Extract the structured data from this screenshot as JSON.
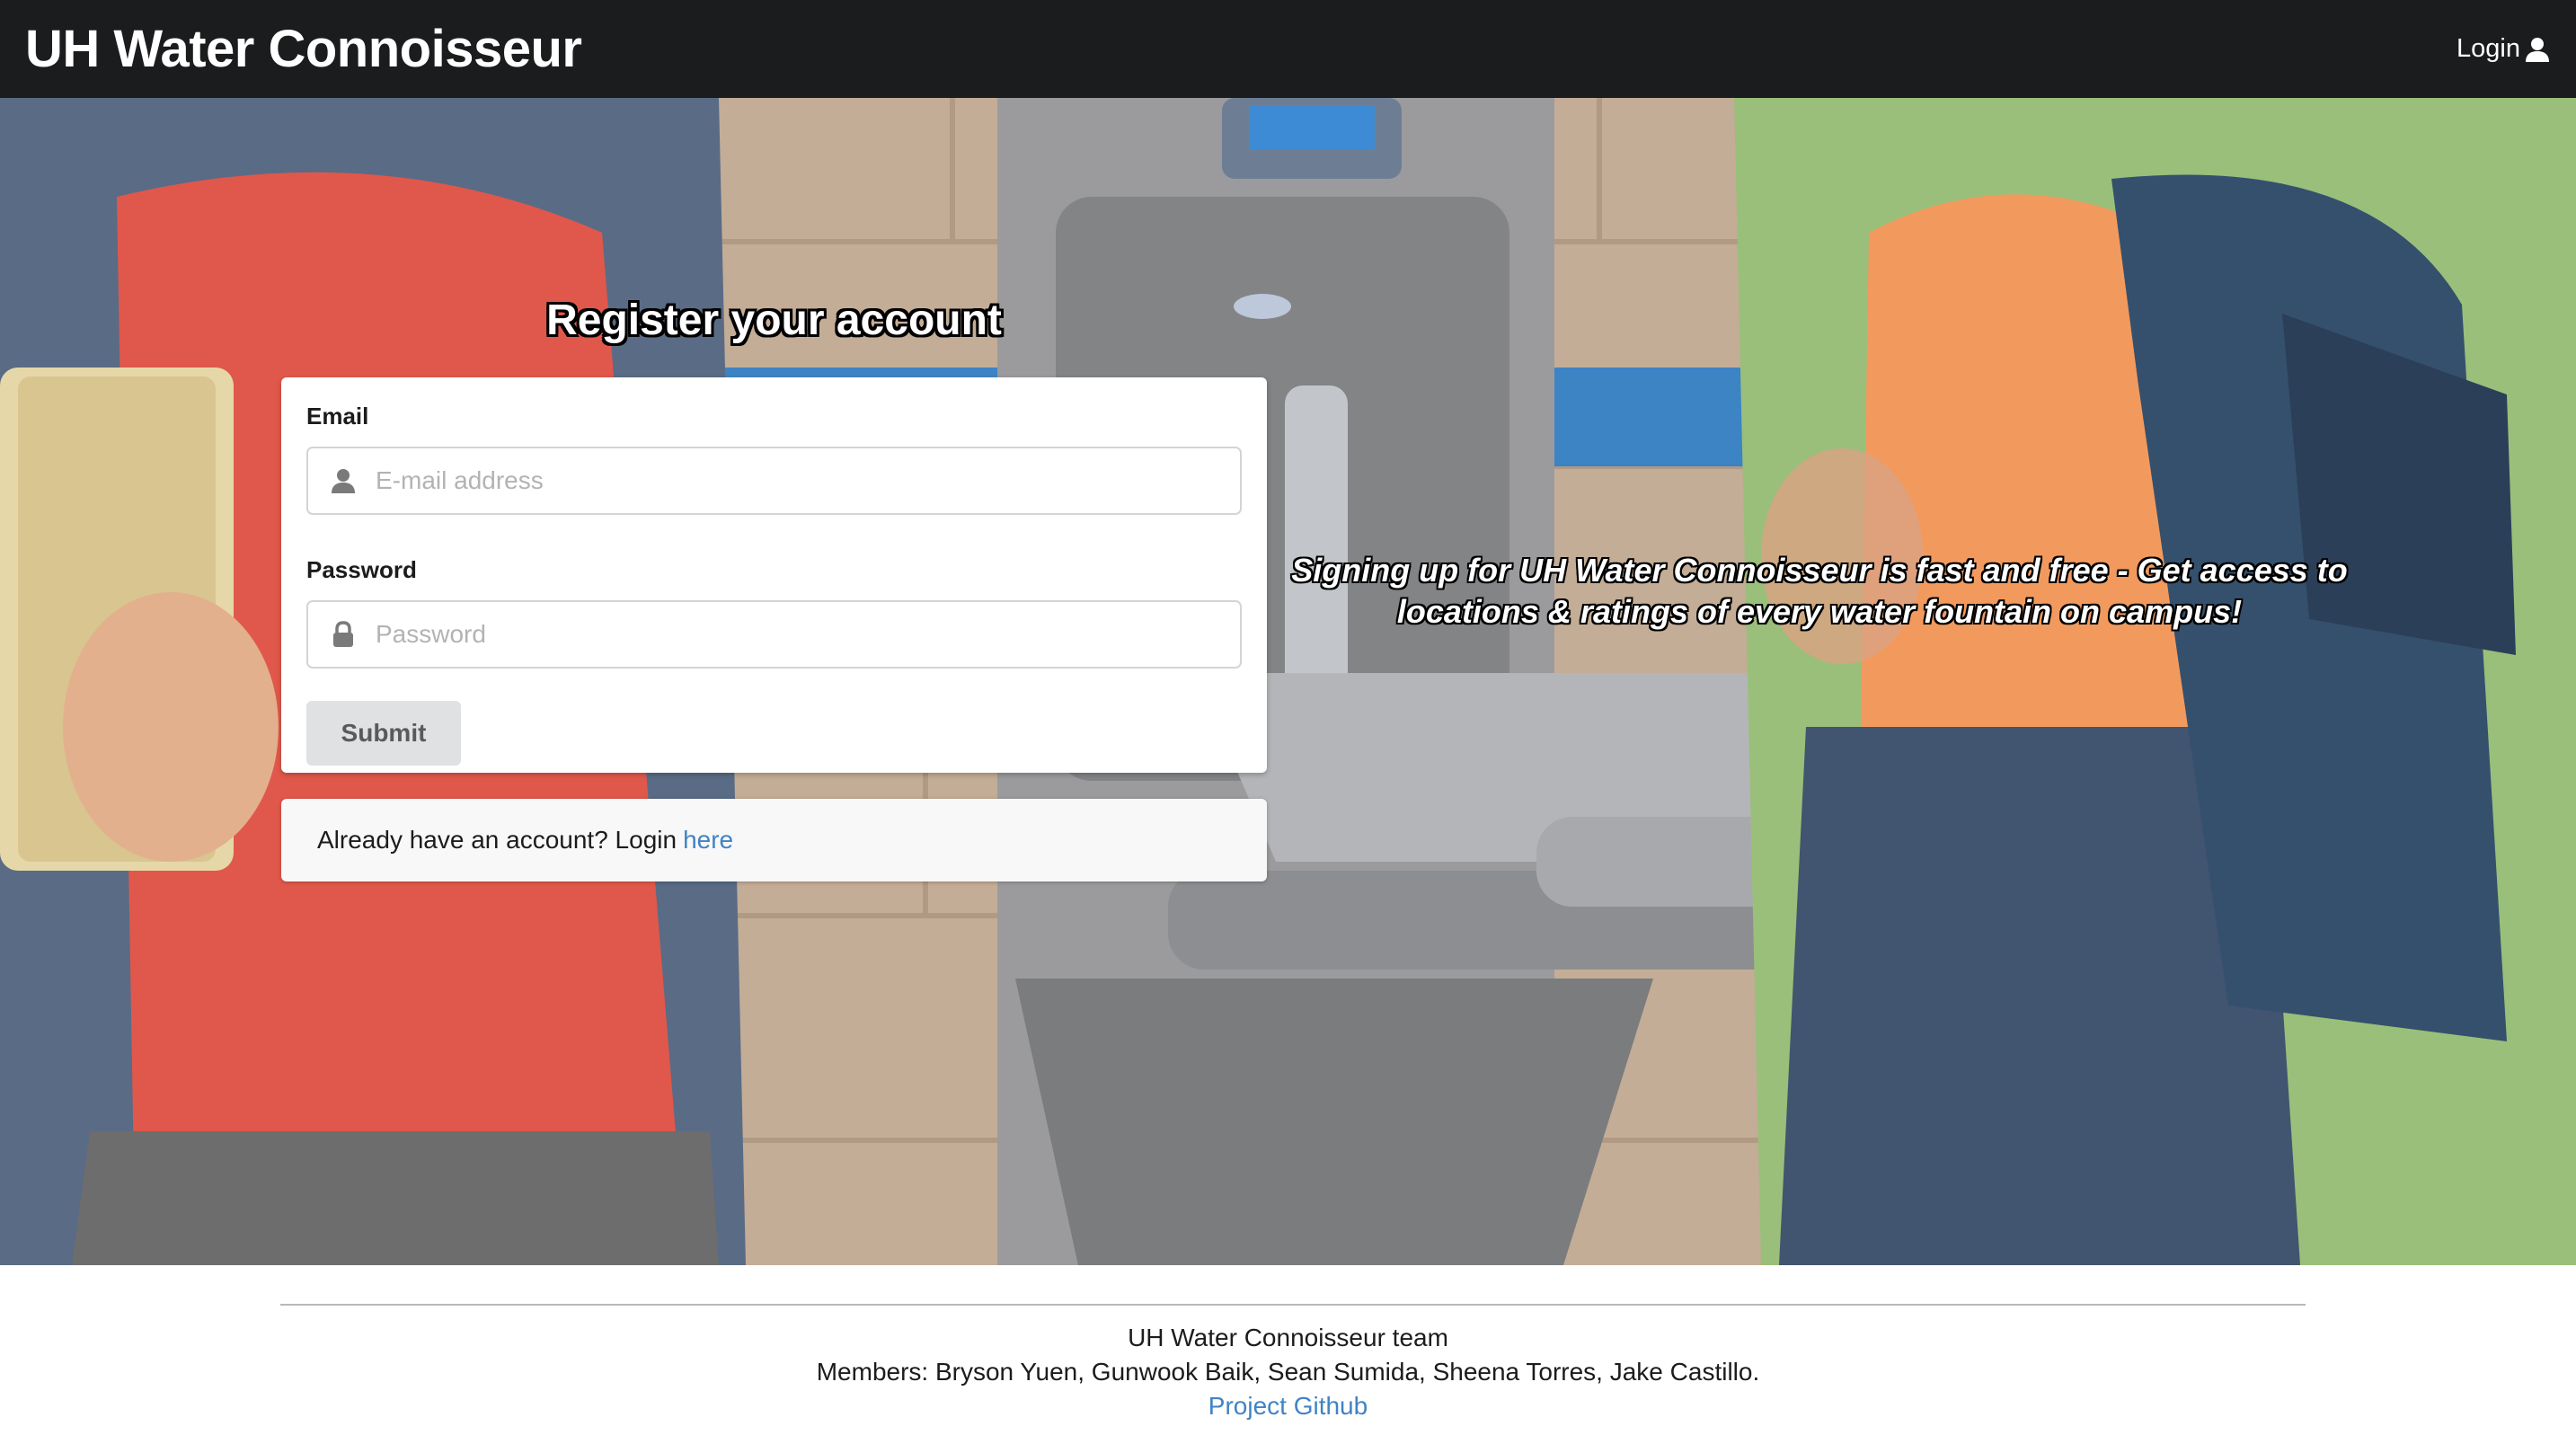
{
  "navbar": {
    "brand": "UH Water Connoisseur",
    "login_label": "Login",
    "login_icon": "user-icon"
  },
  "hero": {
    "title": "Register your account",
    "tagline": "Signing up for UH Water Connoisseur is fast and free - Get access to locations & ratings of every water fountain on campus!",
    "form": {
      "email_label": "Email",
      "email_placeholder": "E-mail address",
      "email_value": "",
      "email_icon": "user-icon",
      "password_label": "Password",
      "password_placeholder": "Password",
      "password_value": "",
      "password_icon": "lock-icon",
      "submit_label": "Submit"
    },
    "login_message": {
      "text": "Already have an account? Login",
      "link_text": "here"
    }
  },
  "footer": {
    "team": "UH Water Connoisseur team",
    "members": "Members: Bryson Yuen, Gunwook Baik, Sean Sumida, Sheena Torres, Jake Castillo.",
    "github_link": "Project Github"
  },
  "colors": {
    "navbar_bg": "#1b1c1d",
    "link": "#4183c4",
    "button_bg": "#e0e1e2"
  }
}
